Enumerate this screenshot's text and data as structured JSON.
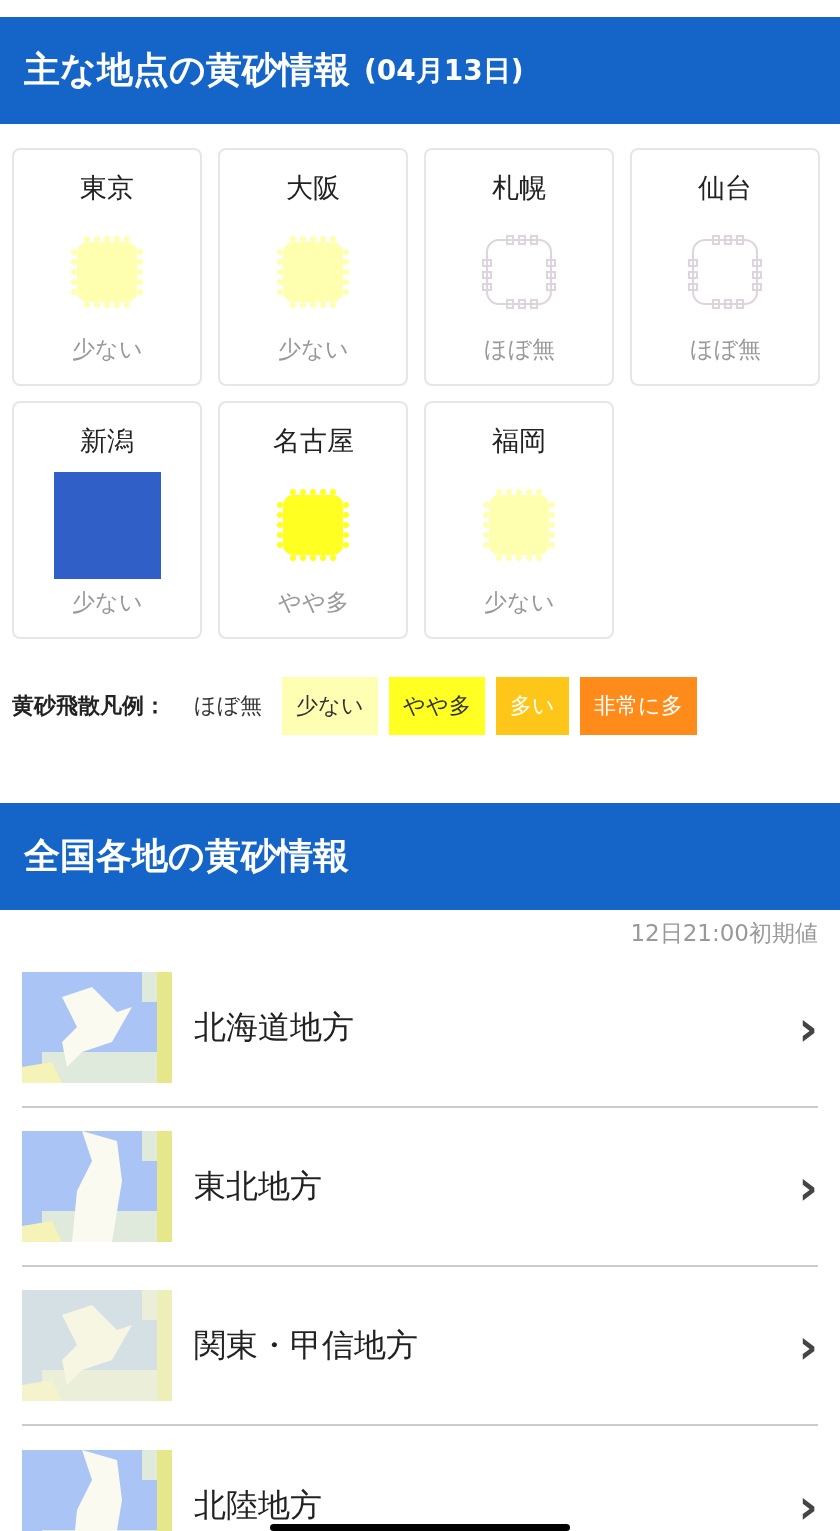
{
  "section1": {
    "title": "主な地点の黄砂情報",
    "date": "(04月13日)"
  },
  "cities": [
    {
      "name": "東京",
      "kind": "blob",
      "color": "#ffffb0",
      "level_text": "少ない"
    },
    {
      "name": "大阪",
      "kind": "blob",
      "color": "#ffffb0",
      "level_text": "少ない"
    },
    {
      "name": "札幌",
      "kind": "ring",
      "color": "#ddd4dd",
      "level_text": "ほぼ無"
    },
    {
      "name": "仙台",
      "kind": "ring",
      "color": "#ddd4dd",
      "level_text": "ほぼ無"
    },
    {
      "name": "新潟",
      "kind": "square",
      "color": "#2f5fc7",
      "level_text": "少ない"
    },
    {
      "name": "名古屋",
      "kind": "blob",
      "color": "#ffff22",
      "level_text": "やや多"
    },
    {
      "name": "福岡",
      "kind": "blob",
      "color": "#ffffb0",
      "level_text": "少ない"
    }
  ],
  "legend": {
    "label": "黄砂飛散凡例：",
    "items": [
      {
        "text": "ほぼ無",
        "kind": "plain"
      },
      {
        "text": "少ない",
        "kind": "chip",
        "color": "#ffffb4"
      },
      {
        "text": "やや多",
        "kind": "chip",
        "color": "#ffff22"
      },
      {
        "text": "多い",
        "kind": "chip_light",
        "color": "#ffc61a"
      },
      {
        "text": "非常に多",
        "kind": "chip_light",
        "color": "#ff8c1a"
      }
    ]
  },
  "section2": {
    "title": "全国各地の黄砂情報",
    "timestamp": "12日21:00初期値"
  },
  "regions": [
    {
      "name": "北海道地方",
      "chevron": "›"
    },
    {
      "name": "東北地方",
      "chevron": "›"
    },
    {
      "name": "関東・甲信地方",
      "chevron": "›"
    },
    {
      "name": "北陸地方",
      "chevron": "›"
    }
  ]
}
